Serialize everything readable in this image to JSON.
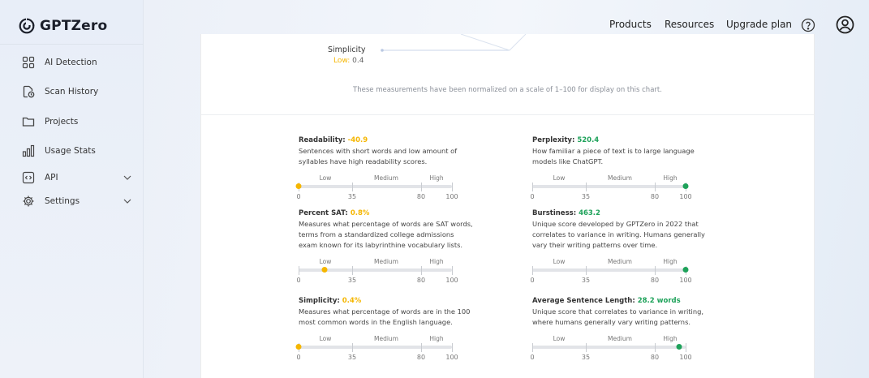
{
  "app": {
    "name": "GPTZero"
  },
  "sidebar": {
    "items": [
      {
        "label": "AI Detection",
        "icon": "grid-icon"
      },
      {
        "label": "Scan History",
        "icon": "file-clock-icon"
      },
      {
        "label": "Projects",
        "icon": "folder-icon"
      },
      {
        "label": "Usage Stats",
        "icon": "bar-chart-icon"
      },
      {
        "label": "API",
        "icon": "code-icon"
      },
      {
        "label": "Settings",
        "icon": "gear-icon"
      }
    ]
  },
  "topnav": {
    "products": "Products",
    "resources": "Resources",
    "upgrade": "Upgrade plan",
    "help_icon": "help-circle-icon",
    "account_icon": "user-circle-icon"
  },
  "radar": {
    "axis_label": "Simplicity",
    "axis_level": "Low:",
    "axis_value": "0.4",
    "note": "These measurements have been normalized on a scale of 1–100 for display on this chart."
  },
  "colors": {
    "low": "#f5b600",
    "high": "#1ea25a"
  },
  "scale_labels": {
    "low": "Low",
    "medium": "Medium",
    "high": "High"
  },
  "metrics": [
    {
      "title": "Readability:",
      "value": "-40.9",
      "desc": "Sentences with short words and low amount of syllables have high readability scores.",
      "ticks": [
        "0",
        "35",
        "80",
        "100"
      ],
      "level": 0
    },
    {
      "title": "Perplexity:",
      "value": "520.4",
      "desc": "How familiar a piece of text is to large language models like ChatGPT.",
      "ticks": [
        "0",
        "35",
        "80",
        "100"
      ],
      "level": 100
    },
    {
      "title": "Percent SAT:",
      "value": "0.8%",
      "desc": "Measures what percentage of words are SAT words, terms from a standardized college admissions exam known for its labyrinthine vocabulary lists.",
      "ticks": [
        "0",
        "35",
        "80",
        "100"
      ],
      "level": 17
    },
    {
      "title": "Burstiness:",
      "value": "463.2",
      "desc": "Unique score developed by GPTZero in 2022 that correlates to variance in writing. Humans generally vary their writing patterns over time.",
      "ticks": [
        "0",
        "35",
        "80",
        "100"
      ],
      "level": 100
    },
    {
      "title": "Simplicity:",
      "value": "0.4%",
      "desc": "Measures what percentage of words are in the 100 most common words in the English language.",
      "ticks": [
        "0",
        "35",
        "80",
        "100"
      ],
      "level": 0
    },
    {
      "title": "Average Sentence Length:",
      "value": "28.2 words",
      "desc": "Unique score that correlates to variance in writing, where humans generally vary writing patterns.",
      "ticks": [
        "0",
        "35",
        "80",
        "100"
      ],
      "level": 96
    }
  ]
}
